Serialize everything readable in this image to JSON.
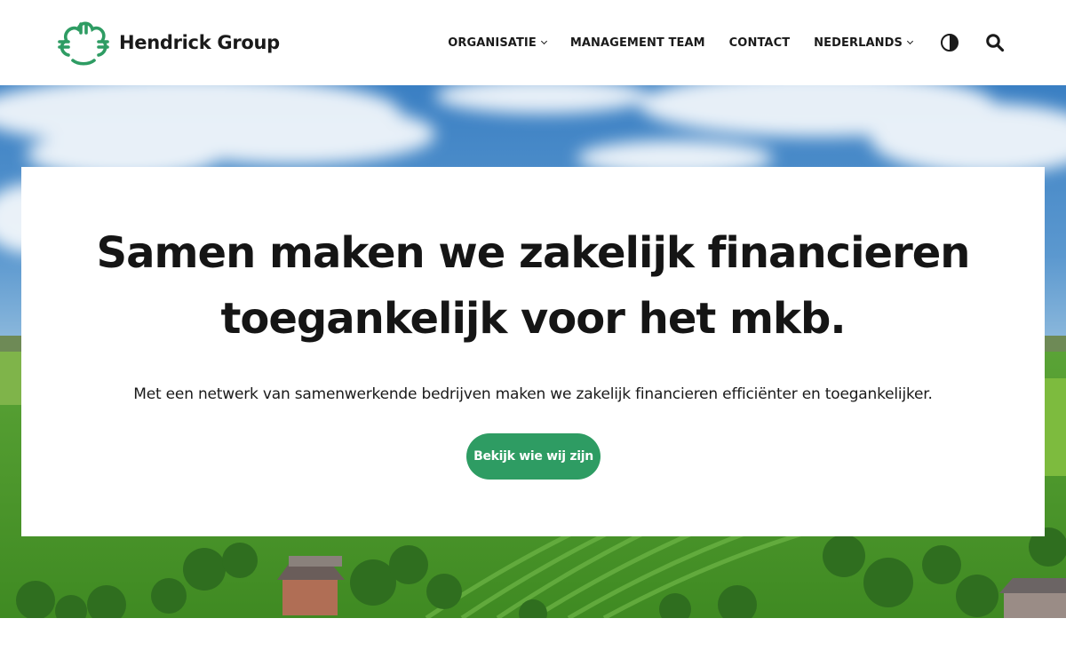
{
  "brand": {
    "name": "Hendrick Group",
    "logo_icon": "euro-cloud-logo-icon",
    "accent": "#2e9c63"
  },
  "nav": {
    "items": [
      {
        "label": "ORGANISATIE",
        "has_dropdown": true
      },
      {
        "label": "MANAGEMENT TEAM",
        "has_dropdown": false
      },
      {
        "label": "CONTACT",
        "has_dropdown": false
      },
      {
        "label": "NEDERLANDS",
        "has_dropdown": true
      }
    ],
    "contrast_icon": "contrast-toggle-icon",
    "search_icon": "search-icon"
  },
  "hero": {
    "title": "Samen maken we zakelijk financieren toegankelijk voor het mkb.",
    "subtitle": "Met een netwerk van samenwerkende bedrijven maken we zakelijk financieren efficiënter en toegankelijker.",
    "cta_label": "Bekijk wie wij zijn",
    "background_image": "aerial-farmland-photo"
  },
  "colors": {
    "text": "#151515",
    "sky": "#3f86c8",
    "grass": "#4f9a2c"
  }
}
